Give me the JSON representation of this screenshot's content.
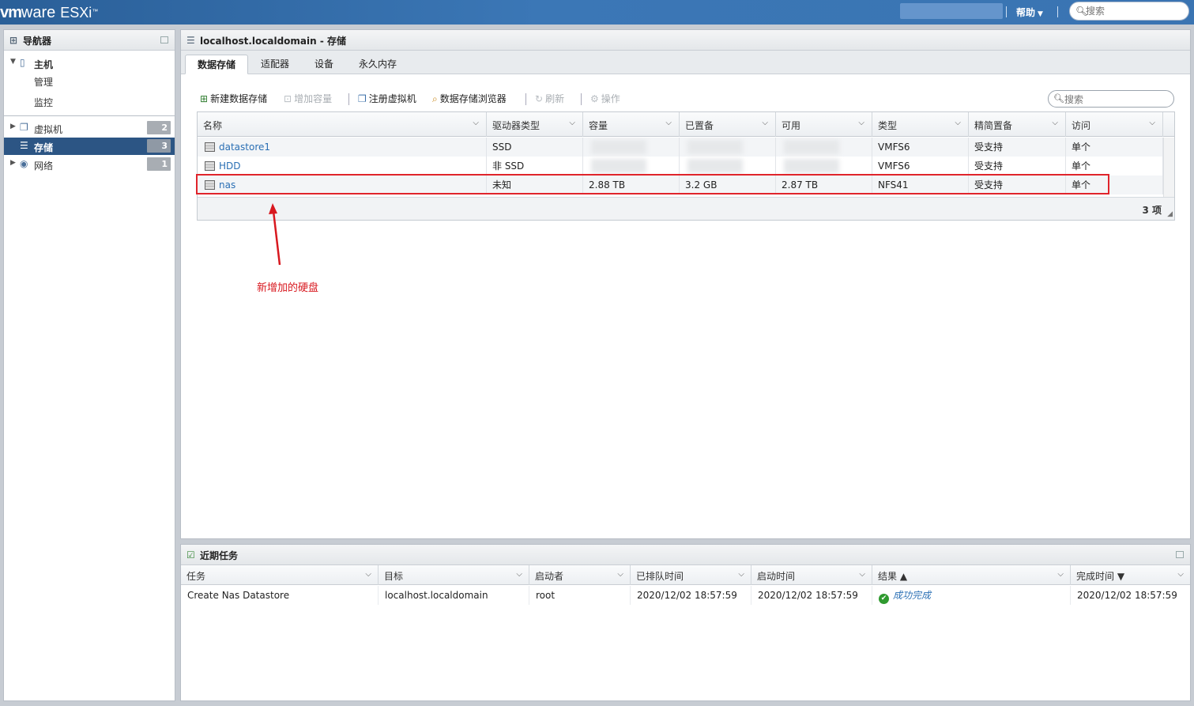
{
  "brand": {
    "vm": "vm",
    "ware": "ware",
    "esxi": "ESXi",
    "tm": "™"
  },
  "topbar": {
    "help": "帮助",
    "search_placeholder": "搜索"
  },
  "navigator": {
    "title": "导航器",
    "host": {
      "label": "主机",
      "children": [
        "管理",
        "监控"
      ]
    },
    "items": [
      {
        "label": "虚拟机",
        "count": "2"
      },
      {
        "label": "存储",
        "count": "3"
      },
      {
        "label": "网络",
        "count": "1"
      }
    ]
  },
  "main": {
    "title": "localhost.localdomain - 存储",
    "tabs": [
      "数据存储",
      "适配器",
      "设备",
      "永久内存"
    ],
    "toolbar": {
      "new_datastore": "新建数据存储",
      "increase_capacity": "增加容量",
      "register_vm": "注册虚拟机",
      "datastore_browser": "数据存储浏览器",
      "refresh": "刷新",
      "actions": "操作"
    },
    "search_placeholder": "搜索",
    "table": {
      "columns": [
        "名称",
        "驱动器类型",
        "容量",
        "已置备",
        "可用",
        "类型",
        "精简置备",
        "访问"
      ],
      "rows": [
        {
          "name": "datastore1",
          "drive": "SSD",
          "capacity": "",
          "provisioned": "",
          "free": "",
          "type": "VMFS6",
          "thin": "受支持",
          "access": "单个"
        },
        {
          "name": "HDD",
          "drive": "非 SSD",
          "capacity": "",
          "provisioned": "",
          "free": "",
          "type": "VMFS6",
          "thin": "受支持",
          "access": "单个"
        },
        {
          "name": "nas",
          "drive": "未知",
          "capacity": "2.88 TB",
          "provisioned": "3.2 GB",
          "free": "2.87 TB",
          "type": "NFS41",
          "thin": "受支持",
          "access": "单个"
        }
      ],
      "count": "3 项"
    },
    "annotation": "新增加的硬盘",
    "annotation_color": "#e0242b"
  },
  "tasks": {
    "title": "近期任务",
    "columns": [
      "任务",
      "目标",
      "启动者",
      "已排队时间",
      "启动时间",
      "结果 ▲",
      "完成时间 ▼"
    ],
    "rows": [
      {
        "task": "Create Nas Datastore",
        "target": "localhost.localdomain",
        "initiator": "root",
        "queued": "2020/12/02 18:57:59",
        "started": "2020/12/02 18:57:59",
        "result": "成功完成",
        "completed": "2020/12/02 18:57:59"
      }
    ]
  }
}
